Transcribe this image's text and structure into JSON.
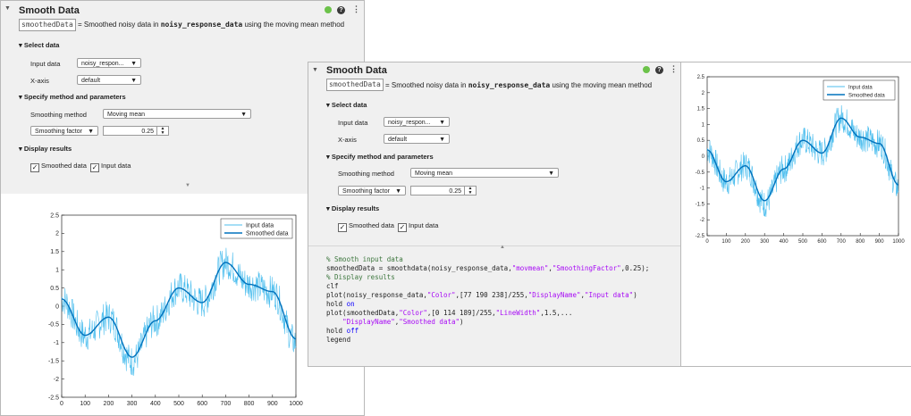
{
  "task_title": "Smooth Data",
  "output_var": "smoothedData",
  "summary": {
    "pre": "= Smoothed noisy data in ",
    "var": "noisy_response_data",
    "post": " using the moving mean method"
  },
  "sections": {
    "select_data": "Select data",
    "method": "Specify method and parameters",
    "display": "Display results"
  },
  "fields": {
    "input_label": "Input data",
    "input_value_left": "noisy_respon...",
    "input_value_right": "noisy_respon...",
    "xaxis_label": "X-axis",
    "xaxis_value": "default",
    "method_label": "Smoothing method",
    "method_value": "Moving mean",
    "factor_select": "Smoothing factor",
    "factor_value": "0.25"
  },
  "checkboxes": {
    "smoothed": "Smoothed data",
    "input": "Input data"
  },
  "code_lines": [
    "% Smooth input data",
    "smoothedData = smoothdata(noisy_response_data,\"movmean\",\"SmoothingFactor\",0.25);",
    "",
    "% Display results",
    "clf",
    "plot(noisy_response_data,\"Color\",[77 190 238]/255,\"DisplayName\",\"Input data\")",
    "hold on",
    "plot(smoothedData,\"Color\",[0 114 189]/255,\"LineWidth\",1.5,...",
    "    \"DisplayName\",\"Smoothed data\")",
    "hold off",
    "legend"
  ],
  "icons": {
    "status": "green-circle",
    "help": "question-mark",
    "more": "vertical-ellipsis",
    "collapse": "triangle-down"
  },
  "colors": {
    "input_line": "#4dbeee",
    "smoothed_line": "#0072bd",
    "status_green": "#6cc24a"
  },
  "chart_data": {
    "type": "line",
    "x": [
      0,
      100,
      200,
      300,
      400,
      500,
      600,
      700,
      800,
      900,
      1000
    ],
    "series": [
      {
        "name": "Input data",
        "color": "#4dbeee",
        "noisy": true,
        "values": [
          0.2,
          -0.8,
          -0.3,
          -1.5,
          -0.4,
          0.5,
          0.1,
          1.2,
          0.6,
          0.4,
          -1.0
        ]
      },
      {
        "name": "Smoothed data",
        "color": "#0072bd",
        "values": [
          0.2,
          -0.8,
          -0.3,
          -1.4,
          -0.4,
          0.5,
          0.1,
          1.2,
          0.6,
          0.4,
          -0.9
        ]
      }
    ],
    "xlim": [
      0,
      1000
    ],
    "ylim": [
      -2.5,
      2.5
    ],
    "xticks": [
      "0",
      "100",
      "200",
      "300",
      "400",
      "500",
      "600",
      "700",
      "800",
      "900",
      "1000"
    ],
    "yticks": [
      "2.5",
      "2",
      "1.5",
      "1",
      "0.5",
      "0",
      "-0.5",
      "-1",
      "-1.5",
      "-2",
      "-2.5"
    ],
    "legend_position": "top-right",
    "grid": false
  }
}
